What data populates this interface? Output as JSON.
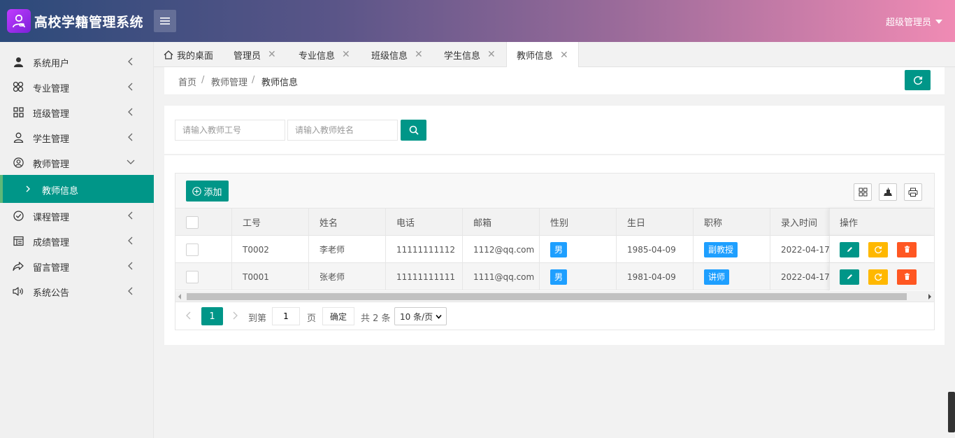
{
  "header": {
    "title": "高校学籍管理系统",
    "user": "超级管理员"
  },
  "sidebar": {
    "items": [
      {
        "label": "系统用户",
        "icon": "user-icon"
      },
      {
        "label": "专业管理",
        "icon": "clover-icon"
      },
      {
        "label": "班级管理",
        "icon": "grid-icon"
      },
      {
        "label": "学生管理",
        "icon": "person-icon"
      },
      {
        "label": "教师管理",
        "icon": "user-circle-icon"
      },
      {
        "label": "课程管理",
        "icon": "check-circle-icon"
      },
      {
        "label": "成绩管理",
        "icon": "template-icon"
      },
      {
        "label": "留言管理",
        "icon": "share-icon"
      },
      {
        "label": "系统公告",
        "icon": "speaker-icon"
      }
    ],
    "sub_active": "教师信息"
  },
  "tabs": [
    {
      "label": "我的桌面",
      "closable": false
    },
    {
      "label": "管理员",
      "closable": true
    },
    {
      "label": "专业信息",
      "closable": true
    },
    {
      "label": "班级信息",
      "closable": true
    },
    {
      "label": "学生信息",
      "closable": true
    },
    {
      "label": "教师信息",
      "closable": true,
      "active": true
    }
  ],
  "tab_close_glyph": "✕",
  "breadcrumb": {
    "home": "首页",
    "section": "教师管理",
    "current": "教师信息",
    "separator": "/"
  },
  "search": {
    "id_placeholder": "请输入教师工号",
    "name_placeholder": "请输入教师姓名"
  },
  "toolbar": {
    "add_label": "添加"
  },
  "table": {
    "columns": [
      "工号",
      "姓名",
      "电话",
      "邮箱",
      "性别",
      "生日",
      "职称",
      "录入时间",
      "操作"
    ],
    "rows": [
      {
        "id": "T0002",
        "name": "李老师",
        "phone": "11111111112",
        "email": "1112@qq.com",
        "gender": "男",
        "birthday": "1985-04-09",
        "title": "副教授",
        "created": "2022-04-17 ..."
      },
      {
        "id": "T0001",
        "name": "张老师",
        "phone": "11111111111",
        "email": "1111@qq.com",
        "gender": "男",
        "birthday": "1981-04-09",
        "title": "讲师",
        "created": "2022-04-17 ..."
      }
    ]
  },
  "pager": {
    "current": "1",
    "goto_label": "到第",
    "page_value": "1",
    "page_unit": "页",
    "confirm": "确定",
    "total": "共 2 条",
    "page_size": "10 条/页"
  },
  "colors": {
    "primary": "#009688",
    "warn": "#ffb800",
    "danger": "#ff5722",
    "info": "#1e9fff"
  }
}
